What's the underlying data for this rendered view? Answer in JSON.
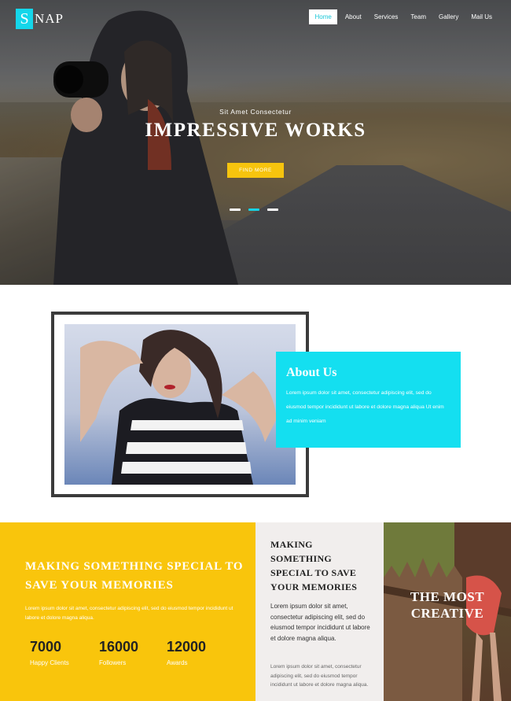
{
  "brand": {
    "initial": "S",
    "rest": "NAP"
  },
  "nav": [
    {
      "label": "Home",
      "active": true
    },
    {
      "label": "About",
      "active": false
    },
    {
      "label": "Services",
      "active": false
    },
    {
      "label": "Team",
      "active": false
    },
    {
      "label": "Gallery",
      "active": false
    },
    {
      "label": "Mail Us",
      "active": false
    }
  ],
  "hero": {
    "kicker": "Sit Amet Consectetur",
    "title": "IMPRESSIVE WORKS",
    "cta": "FIND MORE",
    "slides": 3,
    "active_slide": 2
  },
  "about": {
    "title": "About Us",
    "text": "Lorem ipsum dolor sit amet, consectetur adipiscing elit, sed do eiusmod tempor incididunt ut labore et dolore magna aliqua Ut enim ad minim veniam"
  },
  "special": {
    "title": "MAKING SOMETHING SPECIAL TO SAVE YOUR MEMORIES",
    "text": "Lorem ipsum dolor sit amet, consectetur adipiscing elit, sed do eiusmod tempor incididunt ut labore et dolore magna aliqua.",
    "stats": [
      {
        "value": "7000",
        "label": "Happy Clients"
      },
      {
        "value": "16000",
        "label": "Followers"
      },
      {
        "value": "12000",
        "label": "Awards"
      }
    ]
  },
  "middle": {
    "title": "MAKING SOMETHING SPECIAL TO SAVE YOUR MEMORIES",
    "text": "Lorem ipsum dolor sit amet, consectetur adipiscing elit, sed do eiusmod tempor incididunt ut labore et dolore magna aliqua.",
    "text2": "Lorem ipsum dolor sit amet, consectetur adipiscing elit, sed do eiusmod tempor incididunt ut labore et dolore magna aliqua."
  },
  "creative": {
    "title": "THE MOST CREATIVE"
  },
  "colors": {
    "accent": "#14dff0",
    "yellow": "#f9c50c",
    "dark": "#3b3b3b"
  }
}
